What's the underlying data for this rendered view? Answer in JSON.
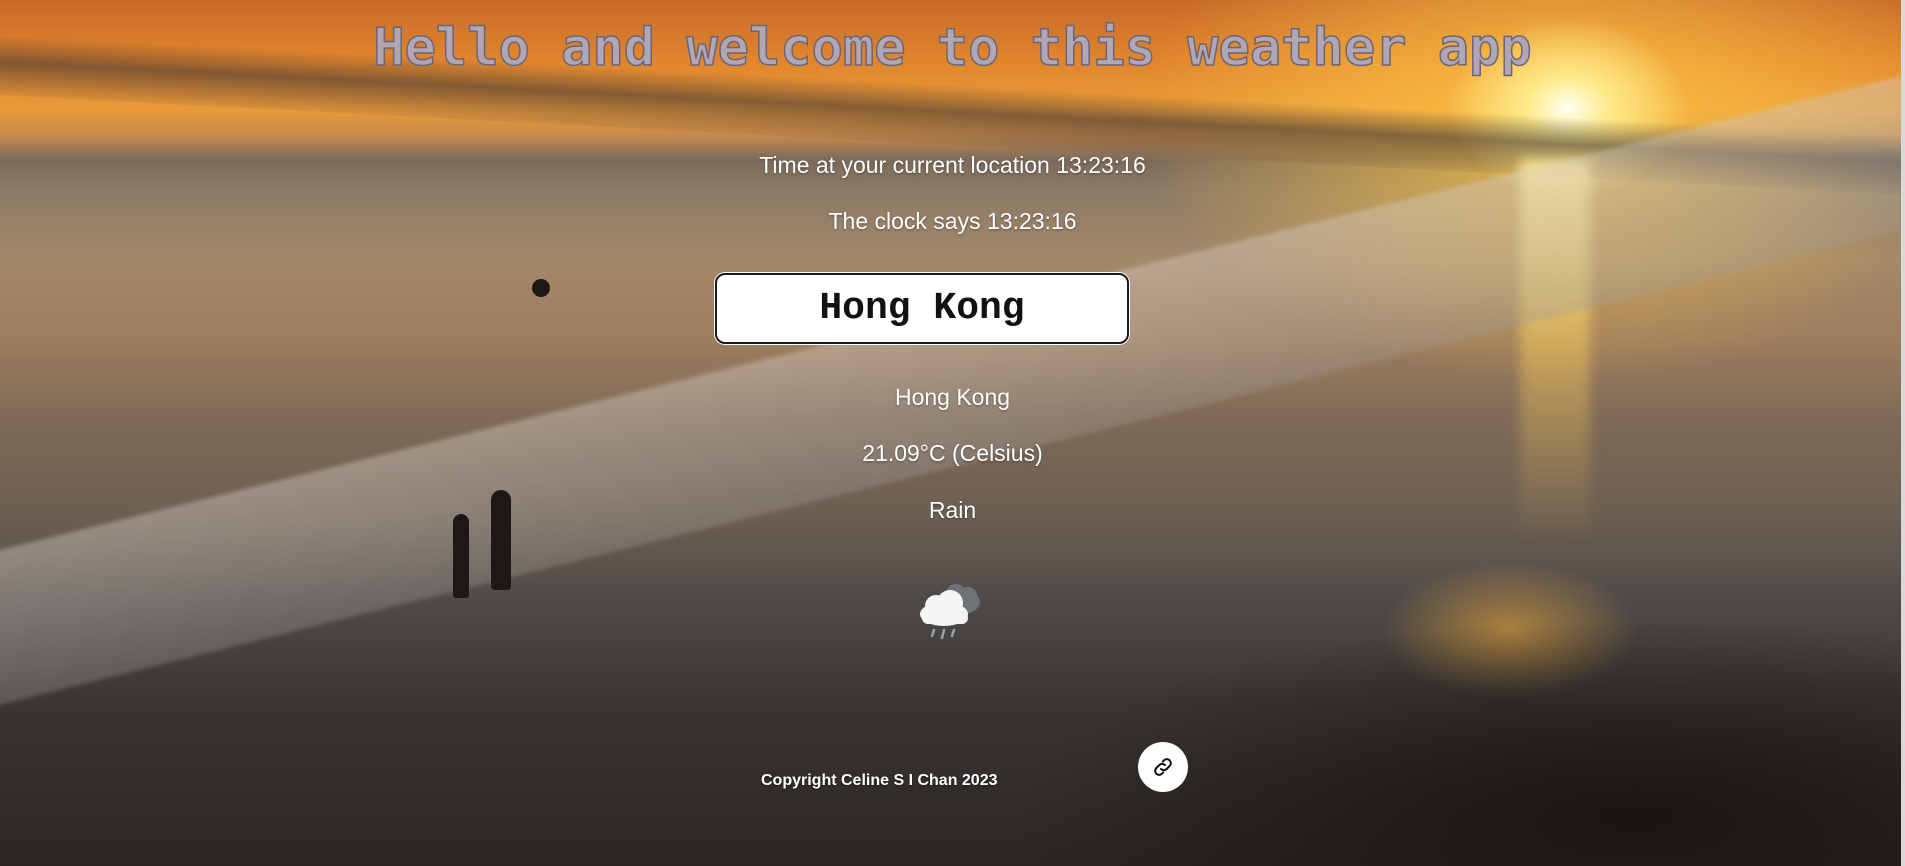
{
  "header": {
    "title": "Hello and welcome to this weather app"
  },
  "clock": {
    "location_time": "Time at your current location 13:23:16",
    "clock_text": "The clock says 13:23:16"
  },
  "search": {
    "value": "Hong Kong"
  },
  "weather": {
    "city": "Hong Kong",
    "temperature": "21.09°C (Celsius)",
    "description": "Rain",
    "icon": "rain-cloud-icon"
  },
  "footer": {
    "copyright": "Copyright Celine S I Chan 2023",
    "link_icon": "link-icon"
  },
  "colors": {
    "title_fill": "#b0a6b4",
    "title_stroke": "#6c6577",
    "text": "#ffffff"
  }
}
